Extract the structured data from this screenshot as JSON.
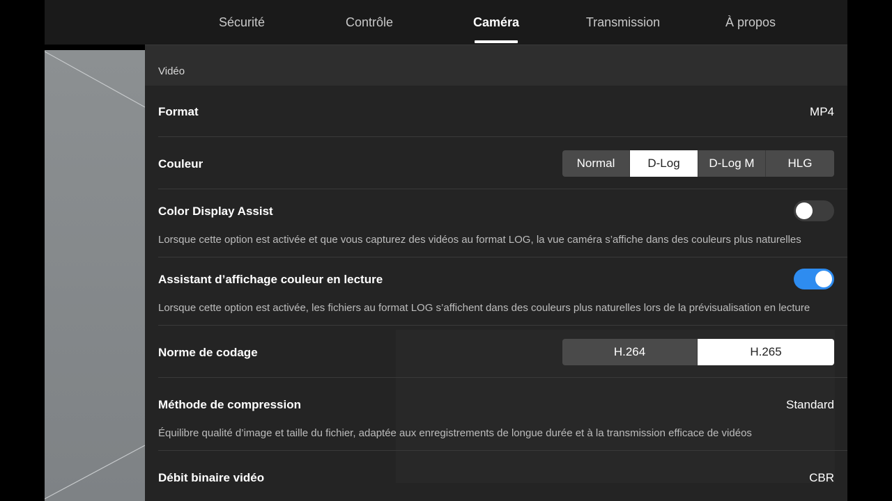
{
  "tabs": [
    {
      "label": "Sécurité"
    },
    {
      "label": "Contrôle"
    },
    {
      "label": "Caméra",
      "active": true
    },
    {
      "label": "Transmission"
    },
    {
      "label": "À propos"
    }
  ],
  "section": {
    "title": "Vidéo"
  },
  "rows": {
    "format": {
      "label": "Format",
      "value": "MP4"
    },
    "couleur": {
      "label": "Couleur",
      "options": [
        "Normal",
        "D-Log",
        "D-Log M",
        "HLG"
      ],
      "selected": "D-Log"
    },
    "color_display_assist": {
      "label": "Color Display Assist",
      "enabled": false,
      "description": "Lorsque cette option est activée et que vous capturez des vidéos au format LOG, la vue caméra s’affiche dans des couleurs plus naturelles"
    },
    "assistant_lecture": {
      "label": "Assistant d’affichage couleur en lecture",
      "enabled": true,
      "description": "Lorsque cette option est activée, les fichiers au format LOG s’affichent dans des couleurs plus naturelles lors de la prévisualisation en lecture"
    },
    "norme_codage": {
      "label": "Norme de codage",
      "options": [
        "H.264",
        "H.265"
      ],
      "selected": "H.265"
    },
    "methode_compression": {
      "label": "Méthode de compression",
      "value": "Standard",
      "description": "Équilibre qualité d’image et taille du fichier, adaptée aux enregistrements de longue durée et à la transmission efficace de vidéos"
    },
    "debit_binaire": {
      "label": "Débit binaire vidéo",
      "value": "CBR"
    }
  },
  "colors": {
    "accent": "#2e8cf0",
    "panel": "#242424",
    "header": "#1a1a1a"
  }
}
